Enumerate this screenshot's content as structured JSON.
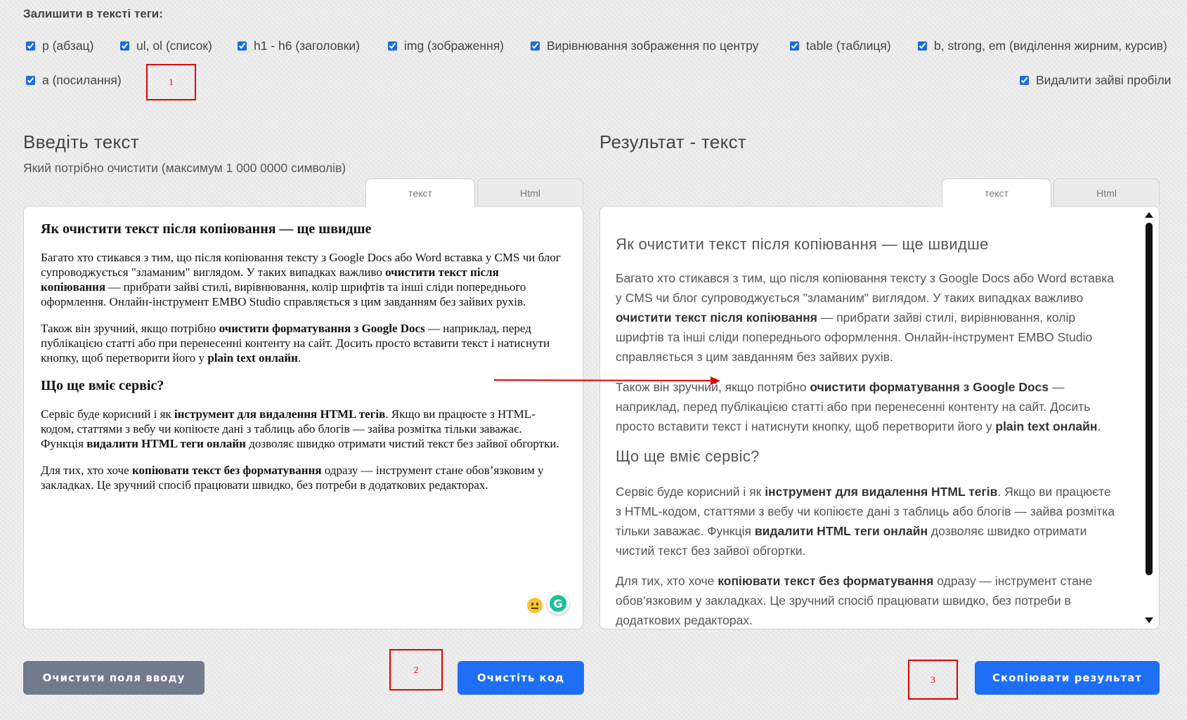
{
  "options": {
    "title": "Залишити в тексті теги:",
    "items": [
      {
        "label": "p (абзац)",
        "checked": true
      },
      {
        "label": "ul, ol (список)",
        "checked": true
      },
      {
        "label": "h1 - h6 (заголовки)",
        "checked": true
      },
      {
        "label": "img (зображення)",
        "checked": true
      },
      {
        "label": "Вирівнювання зображення по центру",
        "checked": true
      },
      {
        "label": "table (таблиця)",
        "checked": true
      },
      {
        "label": "b, strong, em (виділення жирним, курсив)",
        "checked": true
      },
      {
        "label": "a (посилання)",
        "checked": true
      },
      {
        "label": "Видалити зайві пробіли",
        "checked": true
      }
    ]
  },
  "annotations": {
    "box1": "1",
    "box2": "2",
    "box3": "3"
  },
  "colors": {
    "annotation": "#e00000",
    "primary_button": "#1f6ff5",
    "secondary_button": "#727b8c"
  },
  "input": {
    "title": "Введіть текст",
    "subtitle": "Який потрібно очистити (максимум 1 000 0000 символів)",
    "tabs": [
      {
        "label": "текст",
        "active": true
      },
      {
        "label": "Html",
        "active": false
      }
    ]
  },
  "output": {
    "title": "Результат - текст",
    "tabs": [
      {
        "label": "текст",
        "active": true
      },
      {
        "label": "Html",
        "active": false
      }
    ]
  },
  "content": {
    "h1": "Як очистити текст після копіювання — ще швидше",
    "p1_a": "Багато хто стикався з тим, що після копіювання тексту з Google Docs або Word вставка у CMS чи блог супроводжується \"зламаним\" виглядом. У таких випадках важливо ",
    "p1_b": "очистити текст після копіювання",
    "p1_c": " — прибрати зайві стилі, вирівнювання, колір шрифтів та інші сліди попереднього оформлення. Онлайн-інструмент EMBO Studio справляється з цим завданням без зайвих рухів.",
    "p2_a": "Також він зручний, якщо потрібно ",
    "p2_b": "очистити форматування з Google Docs",
    "p2_c": " — наприклад, перед публікацією статті або при перенесенні контенту на сайт. Досить просто вставити текст і натиснути кнопку, щоб перетворити його у ",
    "p2_d": "plain text онлайн",
    "p2_e": ".",
    "h2": "Що ще вміє сервіс?",
    "p3_a": "Сервіс буде корисний і як ",
    "p3_b": "інструмент для видалення HTML тегів",
    "p3_c": ". Якщо ви працюєте з HTML-кодом, статтями з вебу чи копіюєте дані з таблиць або блогів — зайва розмітка тільки заважає. Функція ",
    "p3_d": "видалити HTML теги онлайн",
    "p3_e": " дозволяє швидко отримати чистий текст без зайвої обгортки.",
    "p4_a": "Для тих, хто хоче ",
    "p4_b": "копіювати текст без форматування",
    "p4_c": " одразу — інструмент стане обов’язковим у закладках. Це зручний спосіб працювати швидко, без потреби в додаткових редакторах."
  },
  "buttons": {
    "clear": "Очистити поля вводу",
    "clean": "Очистіть код",
    "copy": "Скопіювати результат"
  }
}
